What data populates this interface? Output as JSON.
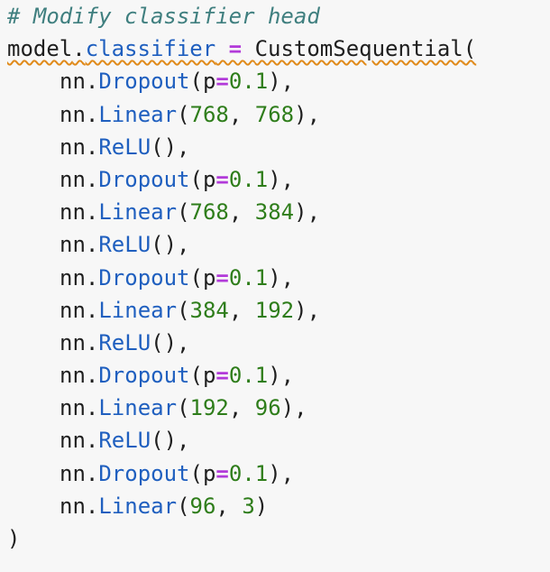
{
  "code": {
    "comment": "# Modify classifier head",
    "assign": {
      "target_obj": "model",
      "dot": ".",
      "target_attr": "classifier",
      "op": " = ",
      "func": "CustomSequential",
      "open": "("
    },
    "layers": [
      {
        "ns": "nn",
        "dot": ".",
        "func": "Dropout",
        "open": "(",
        "kw": "p",
        "op": "=",
        "arg1": "0.1",
        "sep": "",
        "arg2": "",
        "close": "),"
      },
      {
        "ns": "nn",
        "dot": ".",
        "func": "Linear",
        "open": "(",
        "kw": "",
        "op": "",
        "arg1": "768",
        "sep": ", ",
        "arg2": "768",
        "close": "),"
      },
      {
        "ns": "nn",
        "dot": ".",
        "func": "ReLU",
        "open": "(",
        "kw": "",
        "op": "",
        "arg1": "",
        "sep": "",
        "arg2": "",
        "close": "),"
      },
      {
        "ns": "nn",
        "dot": ".",
        "func": "Dropout",
        "open": "(",
        "kw": "p",
        "op": "=",
        "arg1": "0.1",
        "sep": "",
        "arg2": "",
        "close": "),"
      },
      {
        "ns": "nn",
        "dot": ".",
        "func": "Linear",
        "open": "(",
        "kw": "",
        "op": "",
        "arg1": "768",
        "sep": ", ",
        "arg2": "384",
        "close": "),"
      },
      {
        "ns": "nn",
        "dot": ".",
        "func": "ReLU",
        "open": "(",
        "kw": "",
        "op": "",
        "arg1": "",
        "sep": "",
        "arg2": "",
        "close": "),"
      },
      {
        "ns": "nn",
        "dot": ".",
        "func": "Dropout",
        "open": "(",
        "kw": "p",
        "op": "=",
        "arg1": "0.1",
        "sep": "",
        "arg2": "",
        "close": "),"
      },
      {
        "ns": "nn",
        "dot": ".",
        "func": "Linear",
        "open": "(",
        "kw": "",
        "op": "",
        "arg1": "384",
        "sep": ", ",
        "arg2": "192",
        "close": "),"
      },
      {
        "ns": "nn",
        "dot": ".",
        "func": "ReLU",
        "open": "(",
        "kw": "",
        "op": "",
        "arg1": "",
        "sep": "",
        "arg2": "",
        "close": "),"
      },
      {
        "ns": "nn",
        "dot": ".",
        "func": "Dropout",
        "open": "(",
        "kw": "p",
        "op": "=",
        "arg1": "0.1",
        "sep": "",
        "arg2": "",
        "close": "),"
      },
      {
        "ns": "nn",
        "dot": ".",
        "func": "Linear",
        "open": "(",
        "kw": "",
        "op": "",
        "arg1": "192",
        "sep": ", ",
        "arg2": "96",
        "close": "),"
      },
      {
        "ns": "nn",
        "dot": ".",
        "func": "ReLU",
        "open": "(",
        "kw": "",
        "op": "",
        "arg1": "",
        "sep": "",
        "arg2": "",
        "close": "),"
      },
      {
        "ns": "nn",
        "dot": ".",
        "func": "Dropout",
        "open": "(",
        "kw": "p",
        "op": "=",
        "arg1": "0.1",
        "sep": "",
        "arg2": "",
        "close": "),"
      },
      {
        "ns": "nn",
        "dot": ".",
        "func": "Linear",
        "open": "(",
        "kw": "",
        "op": "",
        "arg1": "96",
        "sep": ", ",
        "arg2": "3",
        "close": ")"
      }
    ],
    "closing": ")"
  },
  "colors": {
    "background": "#f7f7f7",
    "comment": "#3f7f7f",
    "attribute": "#1f5fbf",
    "operator": "#b23ad9",
    "number": "#2e7d1a",
    "text": "#1f1f1f",
    "warning_squiggle": "#e08a1a"
  }
}
